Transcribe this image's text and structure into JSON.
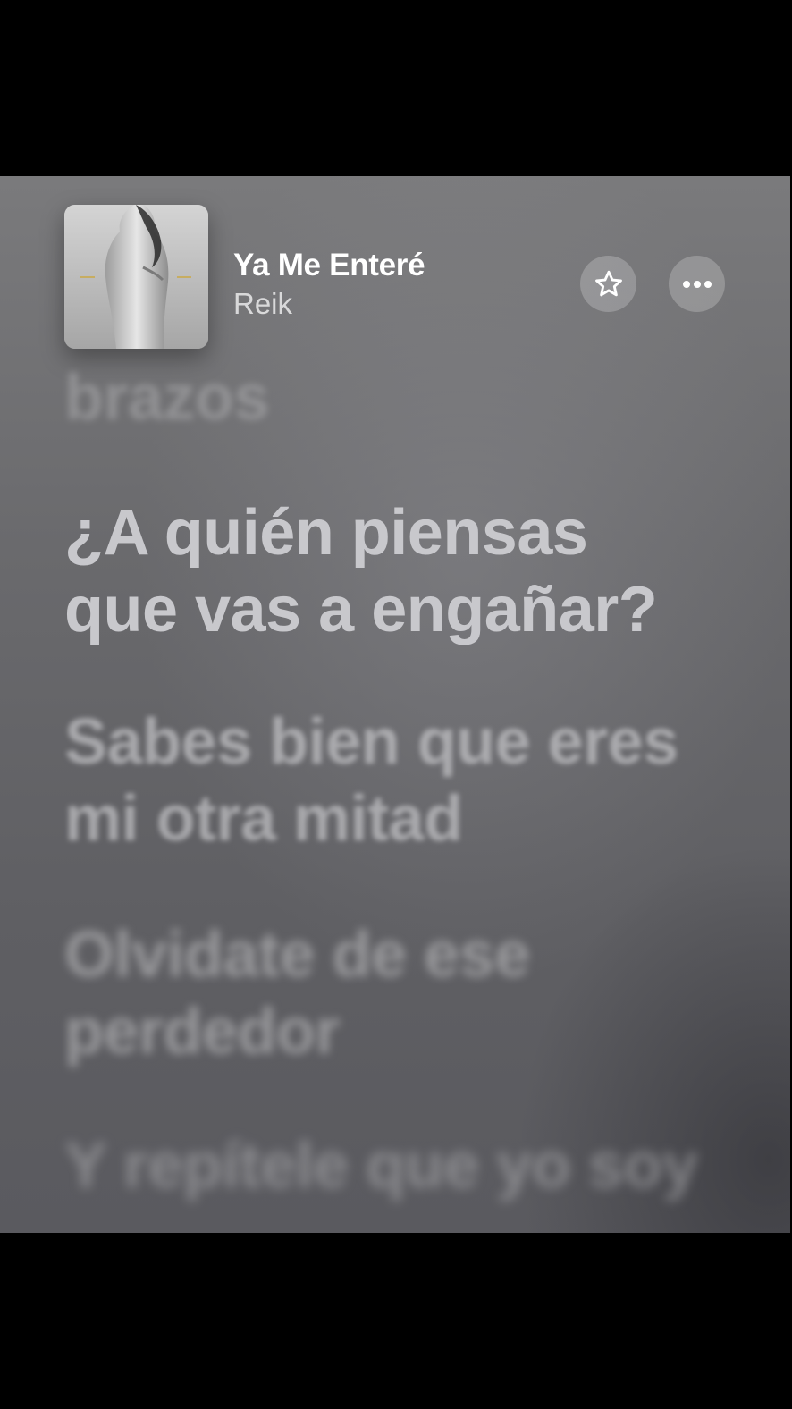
{
  "now_playing": {
    "title": "Ya Me Enteré",
    "artist": "Reik",
    "artwork_icon": "album-artwork"
  },
  "actions": {
    "favorite_icon": "star-icon",
    "more_icon": "more-ellipsis-icon"
  },
  "lyrics": {
    "previous": "brazos",
    "current": "¿A quién piensas que vas a engañar?",
    "upcoming": [
      "Sabes bien que eres mi otra mitad",
      "Olvidate de ese perdedor",
      "Y repítele que yo soy"
    ]
  },
  "colors": {
    "background": "#6a6a6d",
    "current_lyric": "#c8c8cc",
    "title": "#ffffff"
  }
}
